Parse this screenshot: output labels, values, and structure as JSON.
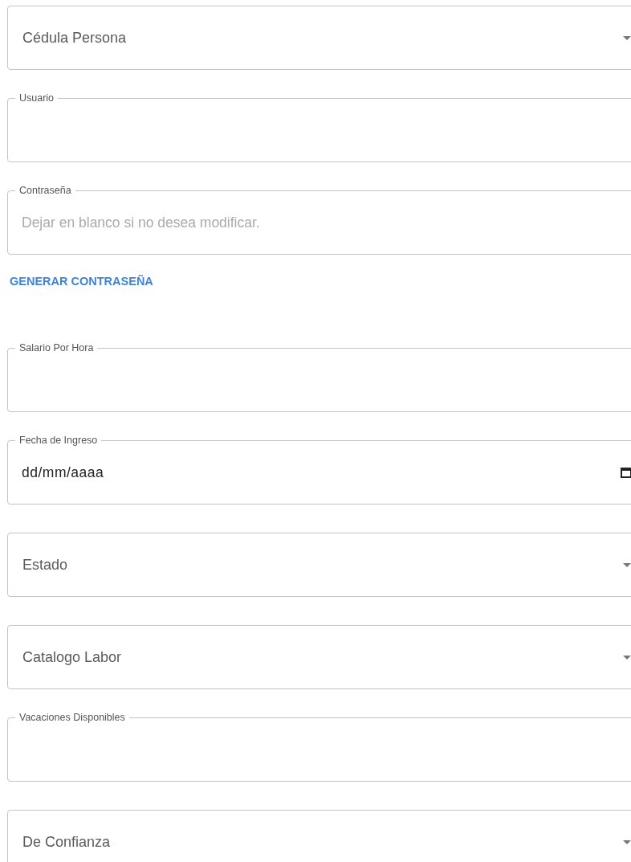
{
  "form": {
    "fields": [
      {
        "kind": "select",
        "label": "Cédula Persona"
      },
      {
        "kind": "text",
        "label": "Usuario"
      },
      {
        "kind": "text",
        "label": "Contraseña",
        "placeholder": "Dejar en blanco si no desea modificar."
      },
      {
        "kind": "button",
        "label": "GENERAR CONTRASEÑA"
      },
      {
        "kind": "text",
        "label": "Salario Por Hora"
      },
      {
        "kind": "date",
        "label": "Fecha de Ingreso",
        "value": "dd/mm/aaaa"
      },
      {
        "kind": "select",
        "label": "Estado"
      },
      {
        "kind": "select",
        "label": "Catalogo Labor"
      },
      {
        "kind": "text",
        "label": "Vacaciones Disponibles"
      },
      {
        "kind": "select",
        "label": "De Confianza"
      }
    ]
  }
}
